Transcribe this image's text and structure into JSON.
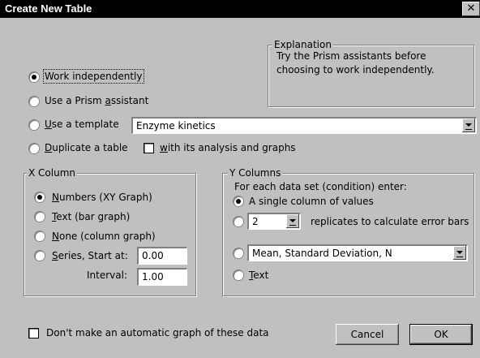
{
  "window": {
    "title": "Create New Table",
    "close_symbol": "✕"
  },
  "explanation": {
    "legend": "Explanation",
    "text_line1": "Try the Prism assistants before",
    "text_line2": "choosing to work independently."
  },
  "mode_options": {
    "work_independently": {
      "label": "Work independently",
      "selected": true
    },
    "use_assistant": {
      "label_pre": "Use a Prism ",
      "label_u": "a",
      "label_post": "ssistant",
      "selected": false
    },
    "use_template": {
      "label_u": "U",
      "label_post": "se a template",
      "selected": false,
      "template_value": "Enzyme kinetics"
    },
    "duplicate": {
      "label_u": "D",
      "label_post": "uplicate a table",
      "selected": false
    },
    "with_analysis": {
      "label_u": "w",
      "label_post": "ith its analysis and graphs",
      "checked": false
    }
  },
  "x_column": {
    "legend": "X Column",
    "numbers": {
      "label_u": "N",
      "label_post": "umbers (XY Graph)",
      "selected": true
    },
    "text": {
      "label_u": "T",
      "label_post": "ext (bar graph)",
      "selected": false
    },
    "none": {
      "label_u": "N",
      "label_post": "one (column graph)",
      "selected": false
    },
    "series": {
      "label_u": "S",
      "label_post": "eries, Start at:",
      "selected": false,
      "start_value": "0.00"
    },
    "interval": {
      "label": "Interval:",
      "value": "1.00"
    }
  },
  "y_columns": {
    "legend": "Y Columns",
    "prompt": "For each data set (condition) enter:",
    "single": {
      "label": "A single column of values",
      "selected": true
    },
    "replicates": {
      "value": "2",
      "label": "replicates to calculate error bars",
      "selected": false
    },
    "mean": {
      "value": "Mean, Standard Deviation, N",
      "selected": false
    },
    "text": {
      "label_u": "T",
      "label_post": "ext",
      "selected": false
    }
  },
  "footer": {
    "no_graph": {
      "label": "Don't make an automatic graph of these data",
      "checked": false
    },
    "cancel": "Cancel",
    "ok": "OK"
  }
}
